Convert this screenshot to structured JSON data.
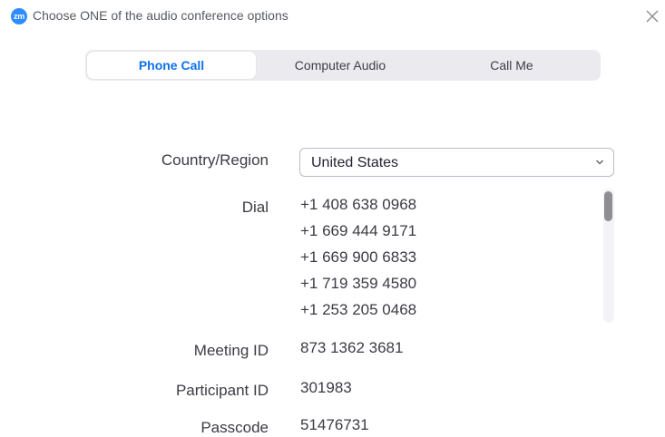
{
  "window": {
    "app_logo_text": "zm",
    "title": "Choose ONE of the audio conference options",
    "close_icon": "close-x-icon"
  },
  "tabs": [
    {
      "label": "Phone Call",
      "active": true
    },
    {
      "label": "Computer Audio",
      "active": false
    },
    {
      "label": "Call Me",
      "active": false
    }
  ],
  "country": {
    "label": "Country/Region",
    "selected": "United States",
    "chevron_icon": "chevron-down-icon"
  },
  "dial": {
    "label": "Dial",
    "numbers": [
      "+1 408 638 0968",
      "+1 669 444 9171",
      "+1 669 900 6833",
      "+1 719 359 4580",
      "+1 253 205 0468"
    ]
  },
  "meeting_id": {
    "label": "Meeting ID",
    "value": "873 1362 3681"
  },
  "participant_id": {
    "label": "Participant ID",
    "value": "301983"
  },
  "passcode": {
    "label": "Passcode",
    "value": "51476731"
  },
  "colors": {
    "accent": "#0e71eb",
    "logo": "#2d8cff",
    "tab_background": "#ebebef"
  }
}
